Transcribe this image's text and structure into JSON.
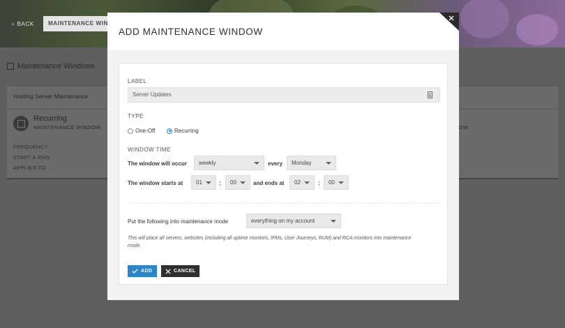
{
  "background": {
    "back_label": "BACK",
    "tab_label": "MAINTENANCE WINDOWS",
    "page_title": "Maintenance Windows",
    "card_title": "Hosting Server Maintenance",
    "recurring_title": "Recurring",
    "recurring_sub": "MAINTENANCE WINDOW",
    "recurring_sub_right": "DW",
    "fields": [
      "FREQUENCY",
      "START & END",
      "APPLIES TO"
    ]
  },
  "modal": {
    "title": "ADD MAINTENANCE WINDOW",
    "label_section": "LABEL",
    "label_value": "Server Updates",
    "type_section": "TYPE",
    "type_options": [
      "One-Off",
      "Recurring"
    ],
    "type_selected": "Recurring",
    "window_time_section": "WINDOW TIME",
    "occur_text": "The window will occur",
    "occur_value": "weekly",
    "every_text": "every",
    "every_value": "Monday",
    "starts_text": "The window starts at",
    "start_hour": "01",
    "start_minute": "00",
    "ends_text": "and ends at",
    "end_hour": "02",
    "end_minute": "00",
    "colon": ":",
    "scope_text": "Put the following into maintenance mode",
    "scope_value": "everything on my account",
    "note": "This will place all servers, websites (including all uptime monitors, IPMs, User Journeys, RUM) and RCA monitors into maintenance mode.",
    "add_label": "ADD",
    "cancel_label": "CANCEL"
  },
  "colors": {
    "accent": "#2a86c8",
    "radio_selected": "#2a84d2",
    "cancel_bg": "#2f2f2f",
    "overlay": "#5f5f5f"
  },
  "icons": [
    "chevron-left-icon",
    "maintenance-icon",
    "close-icon",
    "document-icon",
    "check-icon",
    "x-icon",
    "caret-down-icon"
  ]
}
